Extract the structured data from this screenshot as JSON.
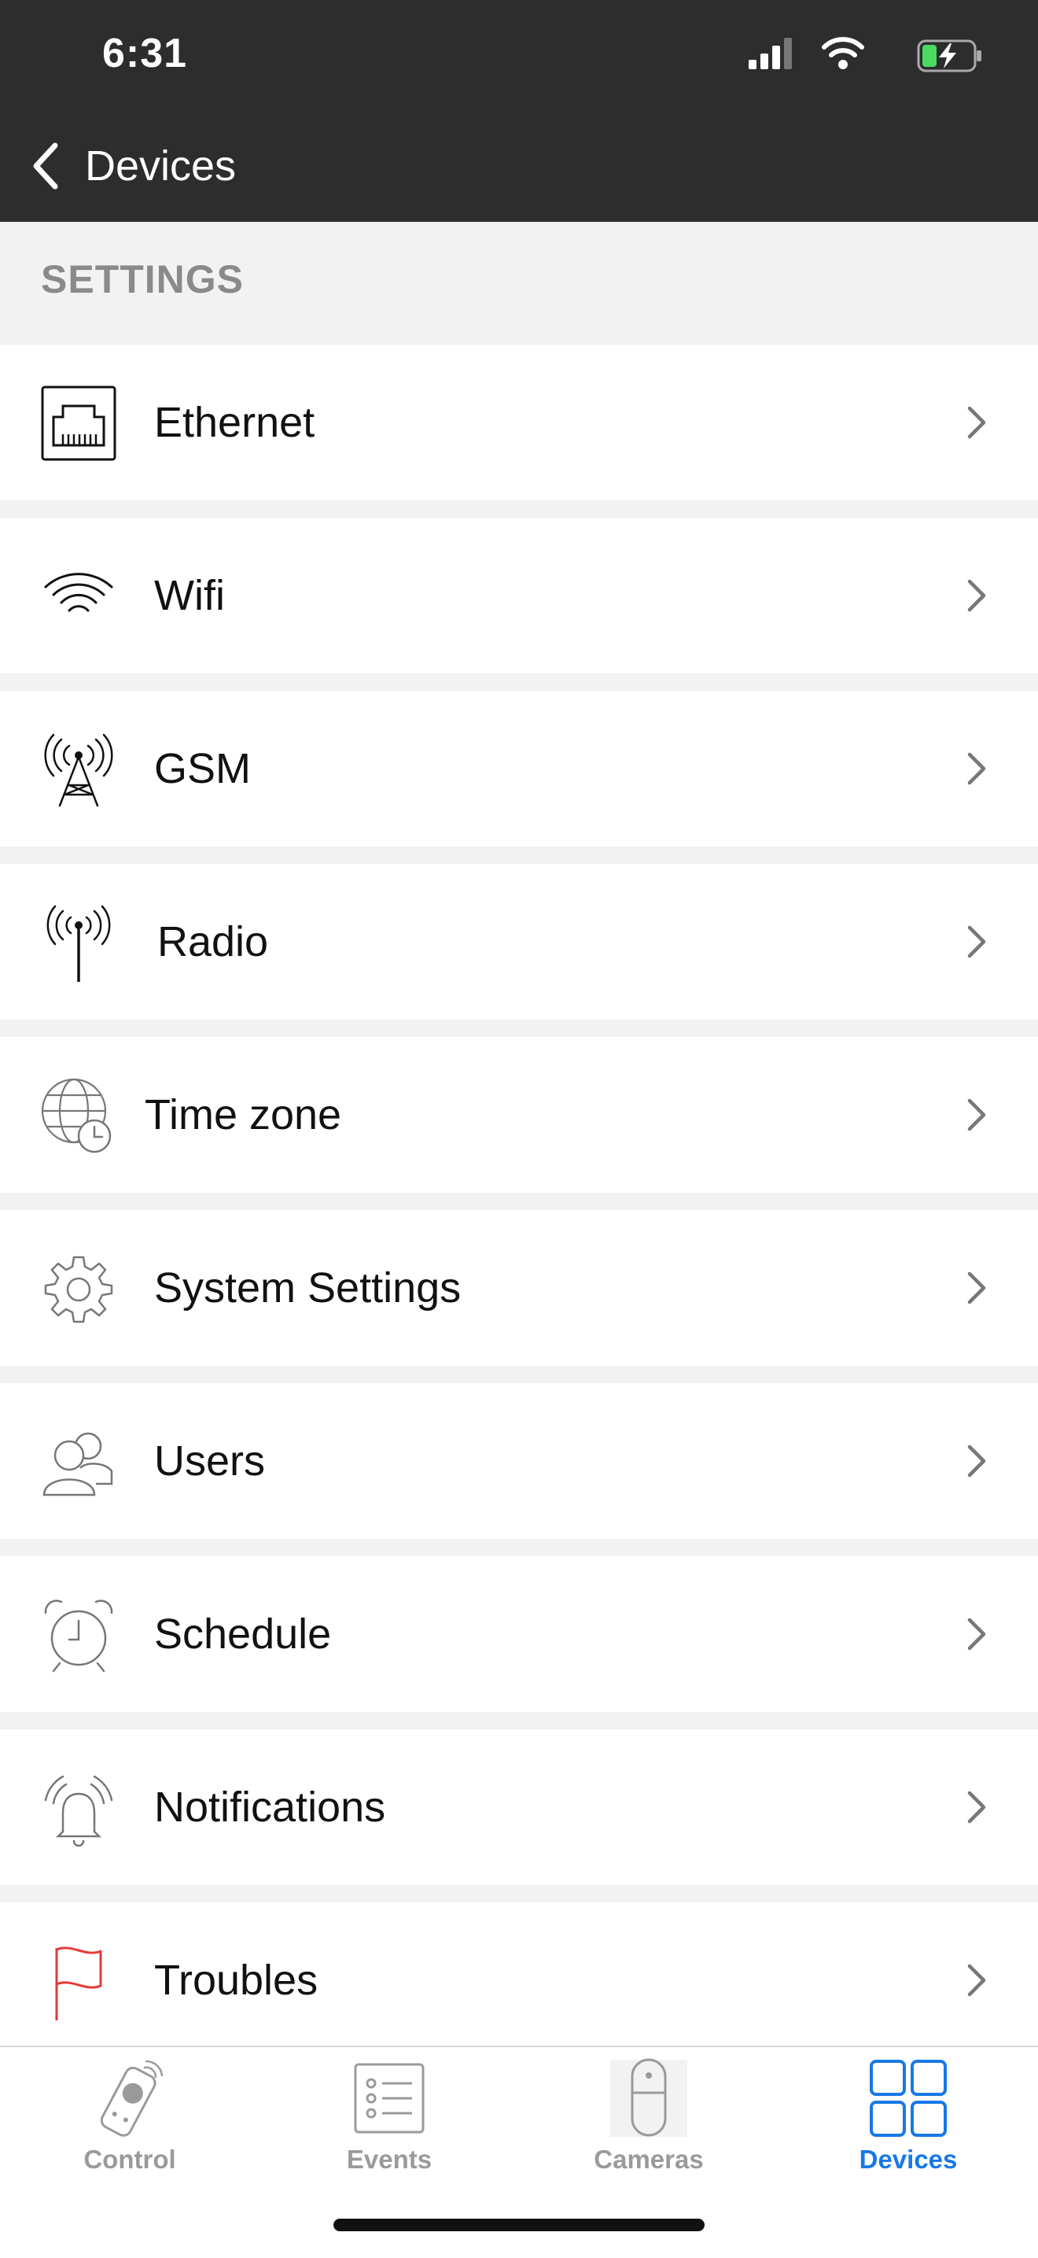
{
  "status": {
    "time": "6:31"
  },
  "nav": {
    "back_label": "Devices"
  },
  "section": {
    "title": "SETTINGS"
  },
  "rows": [
    {
      "label": "Ethernet",
      "icon": "ethernet-icon"
    },
    {
      "label": "Wifi",
      "icon": "wifi-icon"
    },
    {
      "label": "GSM",
      "icon": "cell-tower-icon"
    },
    {
      "label": "Radio",
      "icon": "radio-antenna-icon"
    },
    {
      "label": "Time zone",
      "icon": "globe-clock-icon"
    },
    {
      "label": "System Settings",
      "icon": "gear-icon"
    },
    {
      "label": "Users",
      "icon": "users-icon"
    },
    {
      "label": "Schedule",
      "icon": "alarm-clock-icon"
    },
    {
      "label": "Notifications",
      "icon": "bell-icon"
    },
    {
      "label": "Troubles",
      "icon": "flag-icon"
    }
  ],
  "tabs": [
    {
      "label": "Control",
      "icon": "remote-control-icon",
      "active": false
    },
    {
      "label": "Events",
      "icon": "list-icon",
      "active": false
    },
    {
      "label": "Cameras",
      "icon": "camera-icon",
      "active": false
    },
    {
      "label": "Devices",
      "icon": "devices-grid-icon",
      "active": true
    }
  ],
  "colors": {
    "header_bg": "#2d2d2d",
    "accent": "#1878e6",
    "trouble_red": "#e53935",
    "battery_green": "#4cd964"
  }
}
